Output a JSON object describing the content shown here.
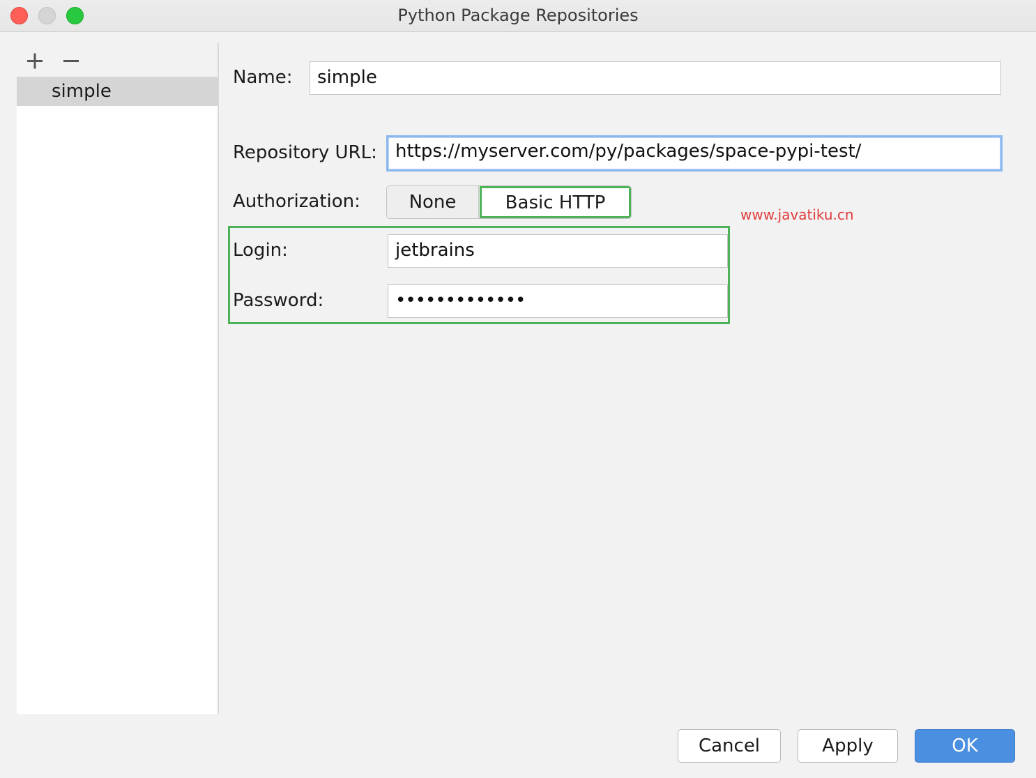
{
  "window": {
    "title": "Python Package Repositories"
  },
  "sidebar": {
    "add_icon": "plus-icon",
    "remove_icon": "minus-icon",
    "items": [
      {
        "label": "simple",
        "selected": true
      }
    ]
  },
  "form": {
    "name_label": "Name:",
    "name_value": "simple",
    "url_label": "Repository URL:",
    "url_value": "https://myserver.com/py/packages/space-pypi-test/",
    "auth_label": "Authorization:",
    "auth_options": [
      "None",
      "Basic HTTP"
    ],
    "auth_selected": "Basic HTTP",
    "login_label": "Login:",
    "login_value": "jetbrains",
    "password_label": "Password:",
    "password_value": "•••••••••••••"
  },
  "watermark": "www.javatiku.cn",
  "buttons": {
    "cancel": "Cancel",
    "apply": "Apply",
    "ok": "OK"
  },
  "colors": {
    "focus": "#8cb8f0",
    "highlight": "#4cb359",
    "primary": "#4a8fe0",
    "watermark": "#e03a3a"
  }
}
